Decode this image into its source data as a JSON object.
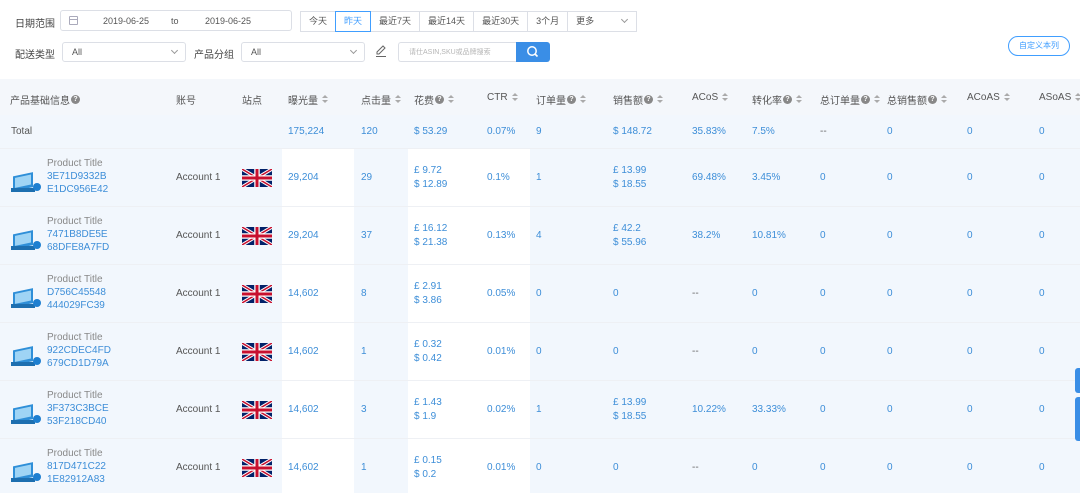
{
  "filters": {
    "date_label": "日期范围",
    "date_start": "2019-06-25",
    "date_to": "to",
    "date_end": "2019-06-25",
    "range_options": [
      "今天",
      "昨天",
      "最近7天",
      "最近14天",
      "最近30天",
      "3个月",
      "更多"
    ],
    "range_active_index": 1,
    "delivery_label": "配送类型",
    "delivery_value": "All",
    "group_label": "产品分组",
    "group_value": "All",
    "search_placeholder": "请仕ASIN,SKU或品牌搜索",
    "custom_columns_label": "自定义本列"
  },
  "table": {
    "headers": {
      "product": "产品基础信息",
      "account": "账号",
      "site": "站点",
      "impressions": "曝光量",
      "clicks": "点击量",
      "spend": "花费",
      "ctr": "CTR",
      "orders": "订单量",
      "sales": "销售额",
      "acos": "ACoS",
      "cvr": "转化率",
      "total_orders": "总订单量",
      "total_sales": "总销售额",
      "acoas": "ACoAS",
      "asoas": "ASoAS"
    },
    "total": {
      "label": "Total",
      "impressions": "175,224",
      "clicks": "120",
      "spend": "$ 53.29",
      "ctr": "0.07%",
      "orders": "9",
      "sales": "$ 148.72",
      "acos": "35.83%",
      "cvr": "7.5%",
      "total_orders": "--",
      "total_sales": "0",
      "acoas": "0",
      "asoas": "0"
    },
    "rows": [
      {
        "title": "Product Title",
        "asin": "3E71D9332B",
        "sku": "E1DC956E42",
        "account": "Account 1",
        "impressions": "29,204",
        "clicks": "29",
        "spend_gbp": "£  9.72",
        "spend_usd": "$ 12.89",
        "ctr": "0.1%",
        "orders": "1",
        "sales_gbp": "£  13.99",
        "sales_usd": "$ 18.55",
        "acos": "69.48%",
        "cvr": "3.45%",
        "total_orders": "0",
        "total_sales": "0",
        "acoas": "0",
        "asoas": "0"
      },
      {
        "title": "Product Title",
        "asin": "7471B8DE5E",
        "sku": "68DFE8A7FD",
        "account": "Account 1",
        "impressions": "29,204",
        "clicks": "37",
        "spend_gbp": "£  16.12",
        "spend_usd": "$ 21.38",
        "ctr": "0.13%",
        "orders": "4",
        "sales_gbp": "£  42.2",
        "sales_usd": "$ 55.96",
        "acos": "38.2%",
        "cvr": "10.81%",
        "total_orders": "0",
        "total_sales": "0",
        "acoas": "0",
        "asoas": "0"
      },
      {
        "title": "Product Title",
        "asin": "D756C45548",
        "sku": "444029FC39",
        "account": "Account 1",
        "impressions": "14,602",
        "clicks": "8",
        "spend_gbp": "£  2.91",
        "spend_usd": "$ 3.86",
        "ctr": "0.05%",
        "orders": "0",
        "sales_gbp": "0",
        "sales_usd": "",
        "acos": "--",
        "cvr": "0",
        "total_orders": "0",
        "total_sales": "0",
        "acoas": "0",
        "asoas": "0"
      },
      {
        "title": "Product Title",
        "asin": "922CDEC4FD",
        "sku": "679CD1D79A",
        "account": "Account 1",
        "impressions": "14,602",
        "clicks": "1",
        "spend_gbp": "£  0.32",
        "spend_usd": "$ 0.42",
        "ctr": "0.01%",
        "orders": "0",
        "sales_gbp": "0",
        "sales_usd": "",
        "acos": "--",
        "cvr": "0",
        "total_orders": "0",
        "total_sales": "0",
        "acoas": "0",
        "asoas": "0"
      },
      {
        "title": "Product Title",
        "asin": "3F373C3BCE",
        "sku": "53F218CD40",
        "account": "Account 1",
        "impressions": "14,602",
        "clicks": "3",
        "spend_gbp": "£  1.43",
        "spend_usd": "$ 1.9",
        "ctr": "0.02%",
        "orders": "1",
        "sales_gbp": "£  13.99",
        "sales_usd": "$ 18.55",
        "acos": "10.22%",
        "cvr": "33.33%",
        "total_orders": "0",
        "total_sales": "0",
        "acoas": "0",
        "asoas": "0"
      },
      {
        "title": "Product Title",
        "asin": "817D471C22",
        "sku": "1E82912A83",
        "account": "Account 1",
        "impressions": "14,602",
        "clicks": "1",
        "spend_gbp": "£  0.15",
        "spend_usd": "$ 0.2",
        "ctr": "0.01%",
        "orders": "0",
        "sales_gbp": "0",
        "sales_usd": "",
        "acos": "--",
        "cvr": "0",
        "total_orders": "0",
        "total_sales": "0",
        "acoas": "0",
        "asoas": "0"
      }
    ]
  },
  "colors": {
    "accent": "#409eff",
    "link": "#3d8ed8",
    "row_bg": "#f2f7fd",
    "header_bg": "#f4f7fb"
  },
  "icons": {
    "calendar": "calendar-icon",
    "edit": "edit-icon",
    "search": "search-icon",
    "product": "product-image-icon",
    "flag": "uk-flag-icon",
    "help": "help-icon",
    "sort": "sort-icon"
  }
}
